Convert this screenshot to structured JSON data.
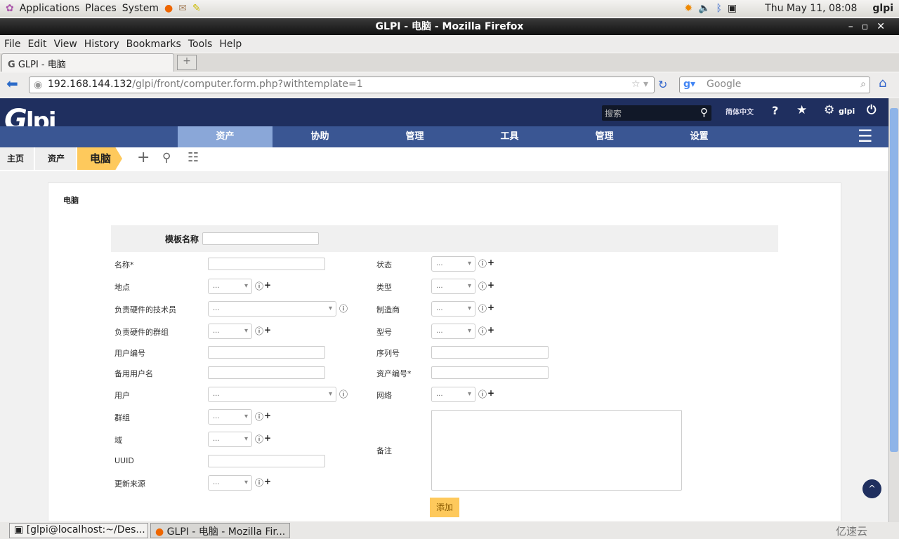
{
  "system": {
    "menus": [
      "Applications",
      "Places",
      "System"
    ],
    "clock": "Thu May 11, 08:08",
    "user": "glpi"
  },
  "window": {
    "title": "GLPI - 电脑 - Mozilla Firefox"
  },
  "browser": {
    "menu": [
      "File",
      "Edit",
      "View",
      "History",
      "Bookmarks",
      "Tools",
      "Help"
    ],
    "tab": "GLPI - 电脑",
    "url_host": "192.168.144.132",
    "url_path": "/glpi/front/computer.form.php?withtemplate=1",
    "search_placeholder": "Google"
  },
  "glpi": {
    "logo": "Glpi",
    "search_placeholder": "搜索",
    "language": "简体中文",
    "user": "glpi",
    "menu": [
      "资产",
      "协助",
      "管理",
      "工具",
      "管理",
      "设置"
    ],
    "breadcrumbs": [
      "主页",
      "资产",
      "电脑"
    ]
  },
  "form": {
    "title": "电脑",
    "template_label": "模板名称",
    "template_value": "",
    "left": [
      {
        "label": "名称*",
        "type": "text"
      },
      {
        "label": "地点",
        "type": "select",
        "value": "...",
        "plus": true
      },
      {
        "label": "负责硬件的技术员",
        "type": "wide",
        "value": "..."
      },
      {
        "label": "负责硬件的群组",
        "type": "select",
        "value": "...",
        "plus": true
      },
      {
        "label": "用户编号",
        "type": "text"
      },
      {
        "label": "备用用户名",
        "type": "text"
      },
      {
        "label": "用户",
        "type": "wide",
        "value": "..."
      },
      {
        "label": "群组",
        "type": "select",
        "value": "...",
        "plus": true
      },
      {
        "label": "域",
        "type": "select",
        "value": "...",
        "plus": true
      },
      {
        "label": "UUID",
        "type": "text"
      },
      {
        "label": "更新来源",
        "type": "select",
        "value": "...",
        "plus": true
      }
    ],
    "right": [
      {
        "label": "状态",
        "type": "select",
        "value": "...",
        "plus": true
      },
      {
        "label": "类型",
        "type": "select",
        "value": "...",
        "plus": true
      },
      {
        "label": "制造商",
        "type": "select",
        "value": "...",
        "plus": true
      },
      {
        "label": "型号",
        "type": "select",
        "value": "...",
        "plus": true
      },
      {
        "label": "序列号",
        "type": "text"
      },
      {
        "label": "资产编号*",
        "type": "text"
      },
      {
        "label": "网络",
        "type": "select",
        "value": "...",
        "plus": true
      }
    ],
    "comment_label": "备注",
    "submit": "添加"
  },
  "taskbar": [
    "[glpi@localhost:~/Des...",
    "GLPI - 电脑 - Mozilla Fir..."
  ],
  "watermark": "亿速云"
}
